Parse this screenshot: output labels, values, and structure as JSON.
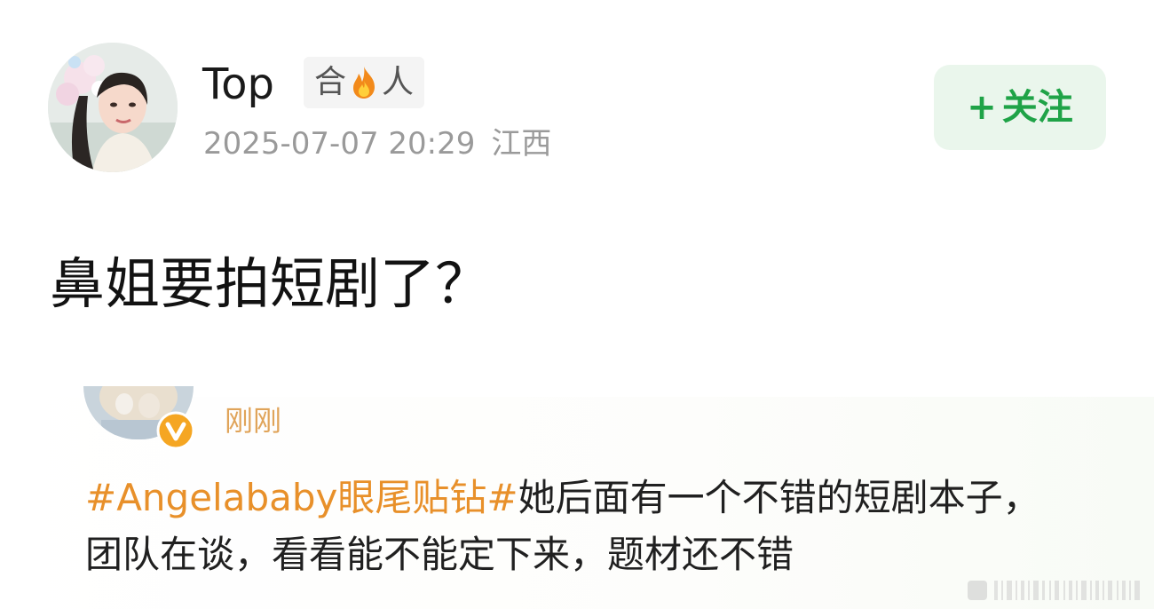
{
  "post": {
    "username": "Top",
    "tag": {
      "prefix": "合",
      "icon": "fire-icon",
      "suffix": "人"
    },
    "timestamp": "2025-07-07 20:29",
    "location": "江西",
    "follow_button": {
      "icon": "plus-icon",
      "plus": "+",
      "label": "关注"
    },
    "text": "鼻姐要拍短剧了？"
  },
  "quoted": {
    "time": "刚刚",
    "verified_icon": "verified-badge-icon",
    "hashtag": "#Angelababy眼尾贴钻#",
    "text": "她后面有一个不错的短剧本子，团队在谈，看看能不能定下来，题材还不错"
  },
  "colors": {
    "follow_green": "#1fa347",
    "follow_bg": "#eaf6ec",
    "hashtag_orange": "#e8902a",
    "meta_gray": "#9a9a9a",
    "time_orange": "#e0a45a",
    "tag_bg": "#f4f4f4"
  }
}
